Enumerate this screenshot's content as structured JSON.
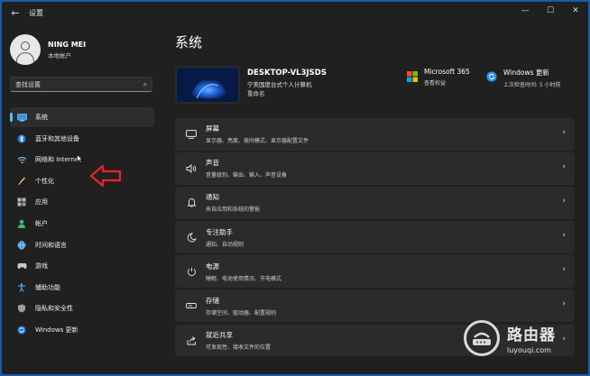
{
  "window": {
    "title": "设置",
    "back_icon": "back-arrow-icon",
    "minimize_glyph": "—",
    "maximize_glyph": "☐",
    "close_glyph": "✕"
  },
  "profile": {
    "name": "NING MEI",
    "type": "本地帐户"
  },
  "search": {
    "placeholder": "查找设置",
    "icon": "search-icon"
  },
  "sidebar": {
    "items": [
      {
        "label": "系统",
        "icon": "display-icon",
        "active": true
      },
      {
        "label": "蓝牙和其他设备",
        "icon": "bluetooth-icon"
      },
      {
        "label": "网络和 Internet",
        "icon": "wifi-icon"
      },
      {
        "label": "个性化",
        "icon": "brush-icon"
      },
      {
        "label": "应用",
        "icon": "apps-icon"
      },
      {
        "label": "帐户",
        "icon": "person-icon"
      },
      {
        "label": "时间和语言",
        "icon": "globe-icon"
      },
      {
        "label": "游戏",
        "icon": "gamepad-icon"
      },
      {
        "label": "辅助功能",
        "icon": "accessibility-icon"
      },
      {
        "label": "隐私和安全性",
        "icon": "shield-icon"
      },
      {
        "label": "Windows 更新",
        "icon": "update-icon"
      }
    ]
  },
  "main": {
    "title": "系统",
    "device": {
      "name": "DESKTOP-VL3JSDS",
      "model": "宁美国度台式个人计算机",
      "rename": "重命名"
    },
    "quick_links": [
      {
        "title": "Microsoft 365",
        "subtitle": "查看权益",
        "icon": "microsoft365-icon"
      },
      {
        "title": "Windows 更新",
        "subtitle": "上次检查时间: 5 小时前",
        "icon": "windows-update-icon"
      }
    ],
    "cards": [
      {
        "title": "屏幕",
        "subtitle": "显示器、亮度、夜间模式、显示器配置文件",
        "icon": "monitor-icon"
      },
      {
        "title": "声音",
        "subtitle": "音量级别、输出、输入、声音设备",
        "icon": "speaker-icon"
      },
      {
        "title": "通知",
        "subtitle": "来自应用和系统的警报",
        "icon": "bell-icon"
      },
      {
        "title": "专注助手",
        "subtitle": "通知、自动规则",
        "icon": "moon-icon"
      },
      {
        "title": "电源",
        "subtitle": "睡眠、电池使用情况、节电模式",
        "icon": "power-icon"
      },
      {
        "title": "存储",
        "subtitle": "存储空间、驱动器、配置规则",
        "icon": "storage-icon"
      },
      {
        "title": "就近共享",
        "subtitle": "可发现性、接收文件的位置",
        "icon": "share-icon"
      }
    ]
  },
  "watermark": {
    "title": "路由器",
    "url": "luyouqi.com"
  },
  "colors": {
    "accent": "#4cc2ff",
    "annotation_arrow": "#e8242a",
    "border": "#1b5aa8"
  }
}
